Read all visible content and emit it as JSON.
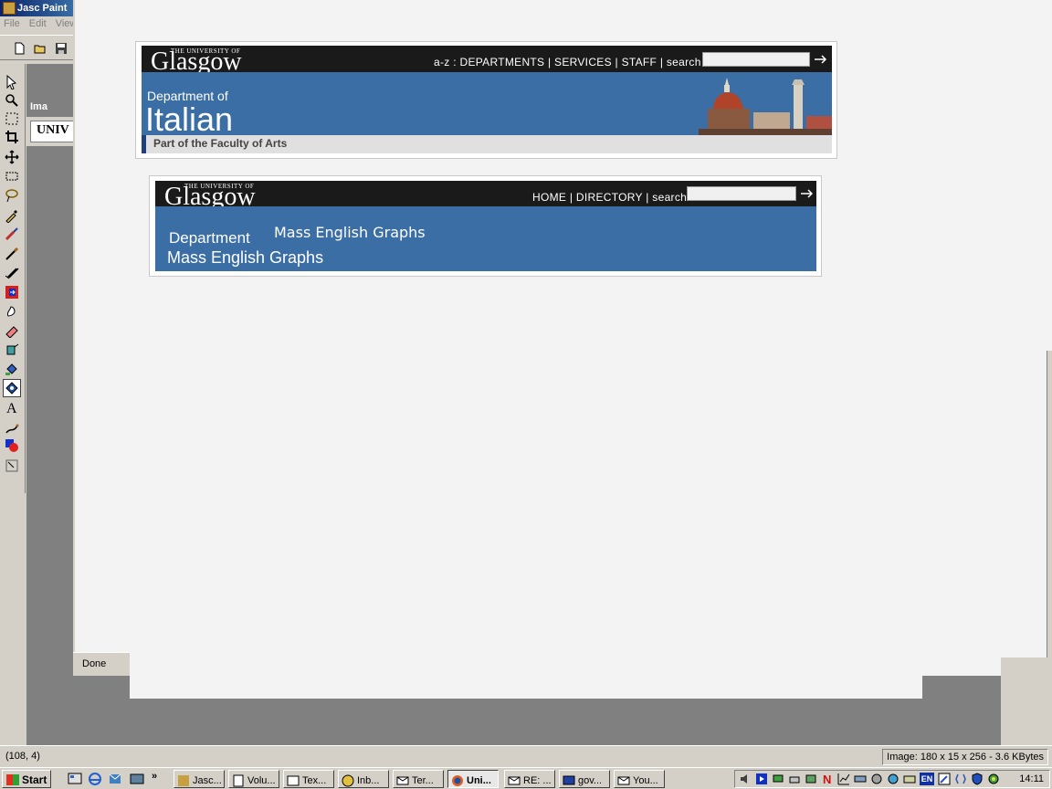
{
  "psp": {
    "title": "Jasc Paint",
    "menu": [
      "File",
      "Edit",
      "View"
    ],
    "image_window_title": "Ima",
    "image_window_text": "UNIV",
    "status_coords": "(108, 4)",
    "status_image_info": "Image:  180 x 15 x 256 - 3.6 KBytes"
  },
  "browser": {
    "status": "Done"
  },
  "banner1": {
    "university_small": "THE UNIVERSITY OF",
    "university_big": "Glasgow",
    "nav": "a-z : DEPARTMENTS  | SERVICES | STAFF | search",
    "dept_of": "Department of",
    "dept_name": "Italian",
    "faculty": "Part of the Faculty of Arts"
  },
  "banner2": {
    "university_small": "THE UNIVERSITY OF",
    "university_big": "Glasgow",
    "nav": "HOME | DIRECTORY | search",
    "dept_line": "Department",
    "overlay_text": "Mass English Graphs",
    "dept_name": "Mass English Graphs"
  },
  "taskbar": {
    "start": "Start",
    "overflow": "»",
    "tasks": [
      "Jasc...",
      "Volu...",
      "Tex...",
      "Inb...",
      "Ter...",
      "Uni...",
      "RE: ...",
      "gov...",
      "You..."
    ],
    "active_task_index": 5,
    "tray_lang": "EN",
    "clock": "14:11"
  },
  "colors": {
    "banner_blue": "#3a6ea5",
    "banner_black": "#1a1a1a",
    "titlebar": "#0a246a",
    "chrome": "#d4d0c8"
  }
}
